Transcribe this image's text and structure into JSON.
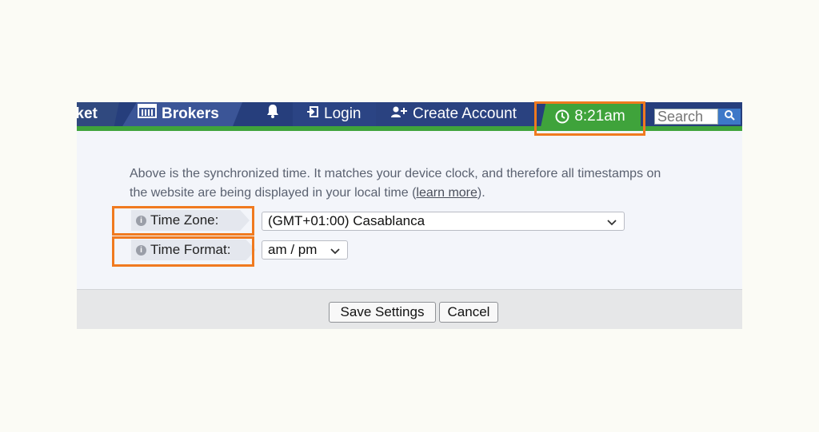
{
  "navbar": {
    "items": [
      {
        "label": "rket",
        "icon": "none"
      },
      {
        "label": "Brokers",
        "icon": "broker-building-icon"
      },
      {
        "label": "",
        "icon": "bell-icon"
      },
      {
        "label": "Login",
        "icon": "login-icon"
      },
      {
        "label": "Create Account",
        "icon": "add-user-icon"
      }
    ],
    "clock": {
      "time": "8:21am",
      "icon": "clock-icon",
      "color": "#3fa33b"
    },
    "search": {
      "placeholder": "Search",
      "icon": "search-icon"
    },
    "bar_color": "#263e7c",
    "accent_color": "#3fa33b"
  },
  "main": {
    "description": "Above is the synchronized time. It matches your device clock, and therefore all timestamps on the website are being displayed in your local time (",
    "learn_more": "learn more",
    "description_end": ").",
    "time_zone": {
      "label": "Time Zone:",
      "value": "(GMT+01:00) Casablanca",
      "icon": "info-icon"
    },
    "time_format": {
      "label": "Time Format:",
      "value": "am / pm",
      "icon": "info-icon"
    }
  },
  "footer": {
    "save_label": "Save Settings",
    "cancel_label": "Cancel"
  },
  "highlight_color": "#f07a1f"
}
